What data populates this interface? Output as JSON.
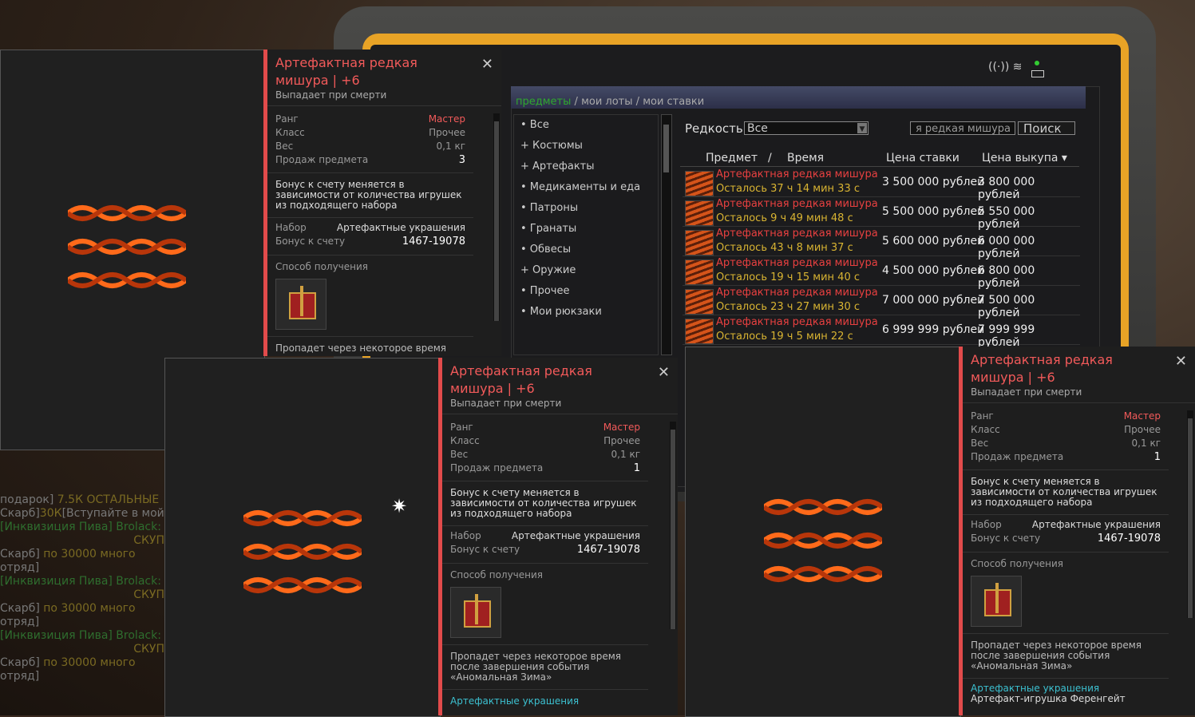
{
  "tabs": {
    "items": [
      "предметы",
      "мои лоты",
      "мои ставки"
    ],
    "separator": "/"
  },
  "categories": [
    "• Все",
    "+ Костюмы",
    "+ Артефакты",
    "• Медикаменты и еда",
    "• Патроны",
    "• Гранаты",
    "• Обвесы",
    "+ Оружие",
    "• Прочее",
    "• Мои рюкзаки"
  ],
  "search": {
    "rarity_label": "Редкость",
    "rarity_value": "Все",
    "query": "я редкая мишура",
    "button": "Поиск"
  },
  "table": {
    "headers": {
      "item": "Предмет",
      "sep": "/",
      "time": "Время",
      "bid": "Цена ставки",
      "buy": "Цена выкупа ▾"
    },
    "rows": [
      {
        "name": "Артефактная редкая мишура",
        "time": "Осталось 37 ч 14 мин 33 с",
        "bid": "3 500 000 рублей",
        "buy": "3 800 000 рублей"
      },
      {
        "name": "Артефактная редкая мишура",
        "time": "Осталось 9 ч 49 мин 48 с",
        "bid": "5 500 000 рублей",
        "buy": "5 550 000 рублей"
      },
      {
        "name": "Артефактная редкая мишура",
        "time": "Осталось 43 ч 8 мин 37 с",
        "bid": "5 600 000 рублей",
        "buy": "6 000 000 рублей"
      },
      {
        "name": "Артефактная редкая мишура",
        "time": "Осталось 19 ч 15 мин 40 с",
        "bid": "4 500 000 рублей",
        "buy": "6 800 000 рублей"
      },
      {
        "name": "Артефактная редкая мишура",
        "time": "Осталось 23 ч 27 мин 30 с",
        "bid": "7 000 000 рублей",
        "buy": "7 500 000 рублей"
      },
      {
        "name": "Артефактная редкая мишура",
        "time": "Осталось 19 ч 5 мин 22 с",
        "bid": "6 999 999 рублей",
        "buy": "7 999 999 рублей"
      }
    ]
  },
  "chat": [
    {
      "a": "подарок]",
      "b": " 7.5К ОСТАЛЬНЫЕ"
    },
    {
      "a": "Скарб]",
      "b": "30К",
      "c": "[Вступайте в мой с"
    },
    {
      "g": "[Инквизиция Пива] Brolack:"
    },
    {
      "c": "СКУП",
      "right": true
    },
    {
      "a": "Скарб]",
      "b": " по 30000 много"
    },
    {
      "a": "отряд]"
    },
    {
      "g": "[Инквизиция Пива] Brolack:"
    },
    {
      "c": "СКУП",
      "right": true
    },
    {
      "a": "Скарб]",
      "b": " по 30000 много"
    },
    {
      "a": "отряд]"
    },
    {
      "g": "[Инквизиция Пива] Brolack:"
    },
    {
      "c": "СКУП",
      "right": true
    },
    {
      "a": "Скарб]",
      "b": " по 30000 много"
    },
    {
      "a": "отряд]"
    }
  ],
  "tooltips": [
    {
      "title": "Артефактная редкая мишура | +6",
      "sub": "Выпадает при смерти",
      "rank_k": "Ранг",
      "rank_v": "Мастер",
      "class_k": "Класс",
      "class_v": "Прочее",
      "weight_k": "Вес",
      "weight_v": "0,1 кг",
      "sales_k": "Продаж предмета",
      "sales_v": "3",
      "bonus": "Бонус к счету меняется в зависимости от количества игрушек из подходящего набора",
      "set_k": "Набор",
      "set_v": "Артефактные украшения",
      "score_k": "Бонус к счету",
      "score_v": "1467-19078",
      "obtain": "Способ получения",
      "expire": "Пропадет через некоторое время после"
    },
    {
      "title": "Артефактная редкая мишура | +6",
      "sub": "Выпадает при смерти",
      "rank_k": "Ранг",
      "rank_v": "Мастер",
      "class_k": "Класс",
      "class_v": "Прочее",
      "weight_k": "Вес",
      "weight_v": "0,1 кг",
      "sales_k": "Продаж предмета",
      "sales_v": "1",
      "bonus": "Бонус к счету меняется в зависимости от количества игрушек из подходящего набора",
      "set_k": "Набор",
      "set_v": "Артефактные украшения",
      "score_k": "Бонус к счету",
      "score_v": "1467-19078",
      "obtain": "Способ получения",
      "expire": "Пропадет через некоторое время после завершения события «Аномальная Зима»",
      "footer1": "Артефактные украшения"
    },
    {
      "title": "Артефактная редкая мишура | +6",
      "sub": "Выпадает при смерти",
      "rank_k": "Ранг",
      "rank_v": "Мастер",
      "class_k": "Класс",
      "class_v": "Прочее",
      "weight_k": "Вес",
      "weight_v": "0,1 кг",
      "sales_k": "Продаж предмета",
      "sales_v": "1",
      "bonus": "Бонус к счету меняется в зависимости от количества игрушек из подходящего набора",
      "set_k": "Набор",
      "set_v": "Артефактные украшения",
      "score_k": "Бонус к счету",
      "score_v": "1467-19078",
      "obtain": "Способ получения",
      "expire": "Пропадет через некоторое время после завершения события «Аномальная Зима»",
      "footer1": "Артефактные украшения",
      "footer2": "Артефакт-игрушка Ференгейт"
    }
  ],
  "colors": {
    "accent_red": "#e24b4b",
    "time_yellow": "#d9b432",
    "tab_green": "#2fa72f"
  }
}
